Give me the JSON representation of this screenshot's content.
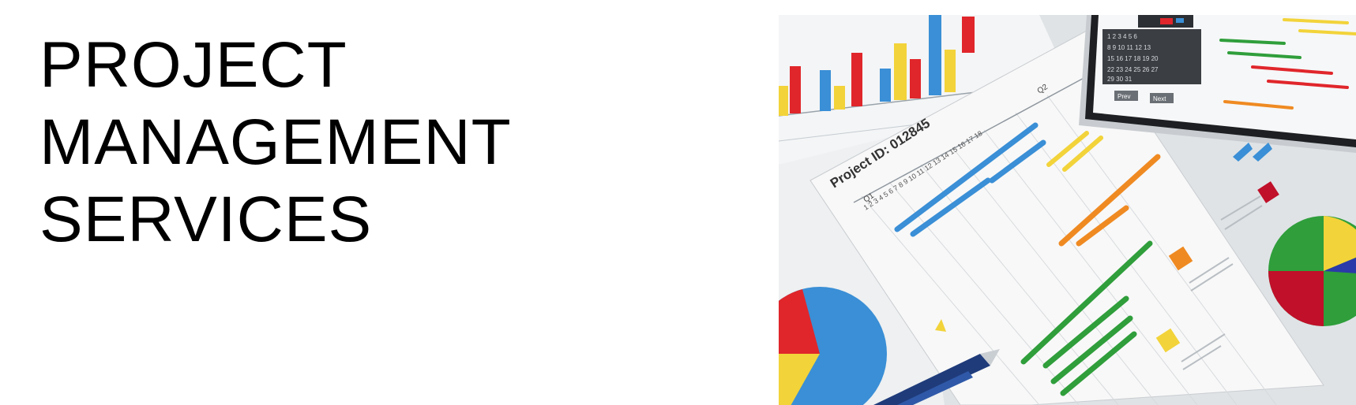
{
  "heading": {
    "line1": "PROJECT",
    "line2": "MANAGEMENT",
    "line3": "SERVICES"
  },
  "photo": {
    "project_id": "Project ID: 012845",
    "quarter1": "Q1",
    "quarter2": "Q2",
    "week_numbers": "1 2 3 4 5 6 7 8 9 10 11 12 13 14 15 16 17 18",
    "tablet_prev": "Prev",
    "tablet_next": "Next",
    "colors": {
      "blue": "#3a8fd6",
      "orange": "#ef8a22",
      "green": "#2f9e3b",
      "yellow": "#f2d33a",
      "red": "#e0262b"
    }
  }
}
